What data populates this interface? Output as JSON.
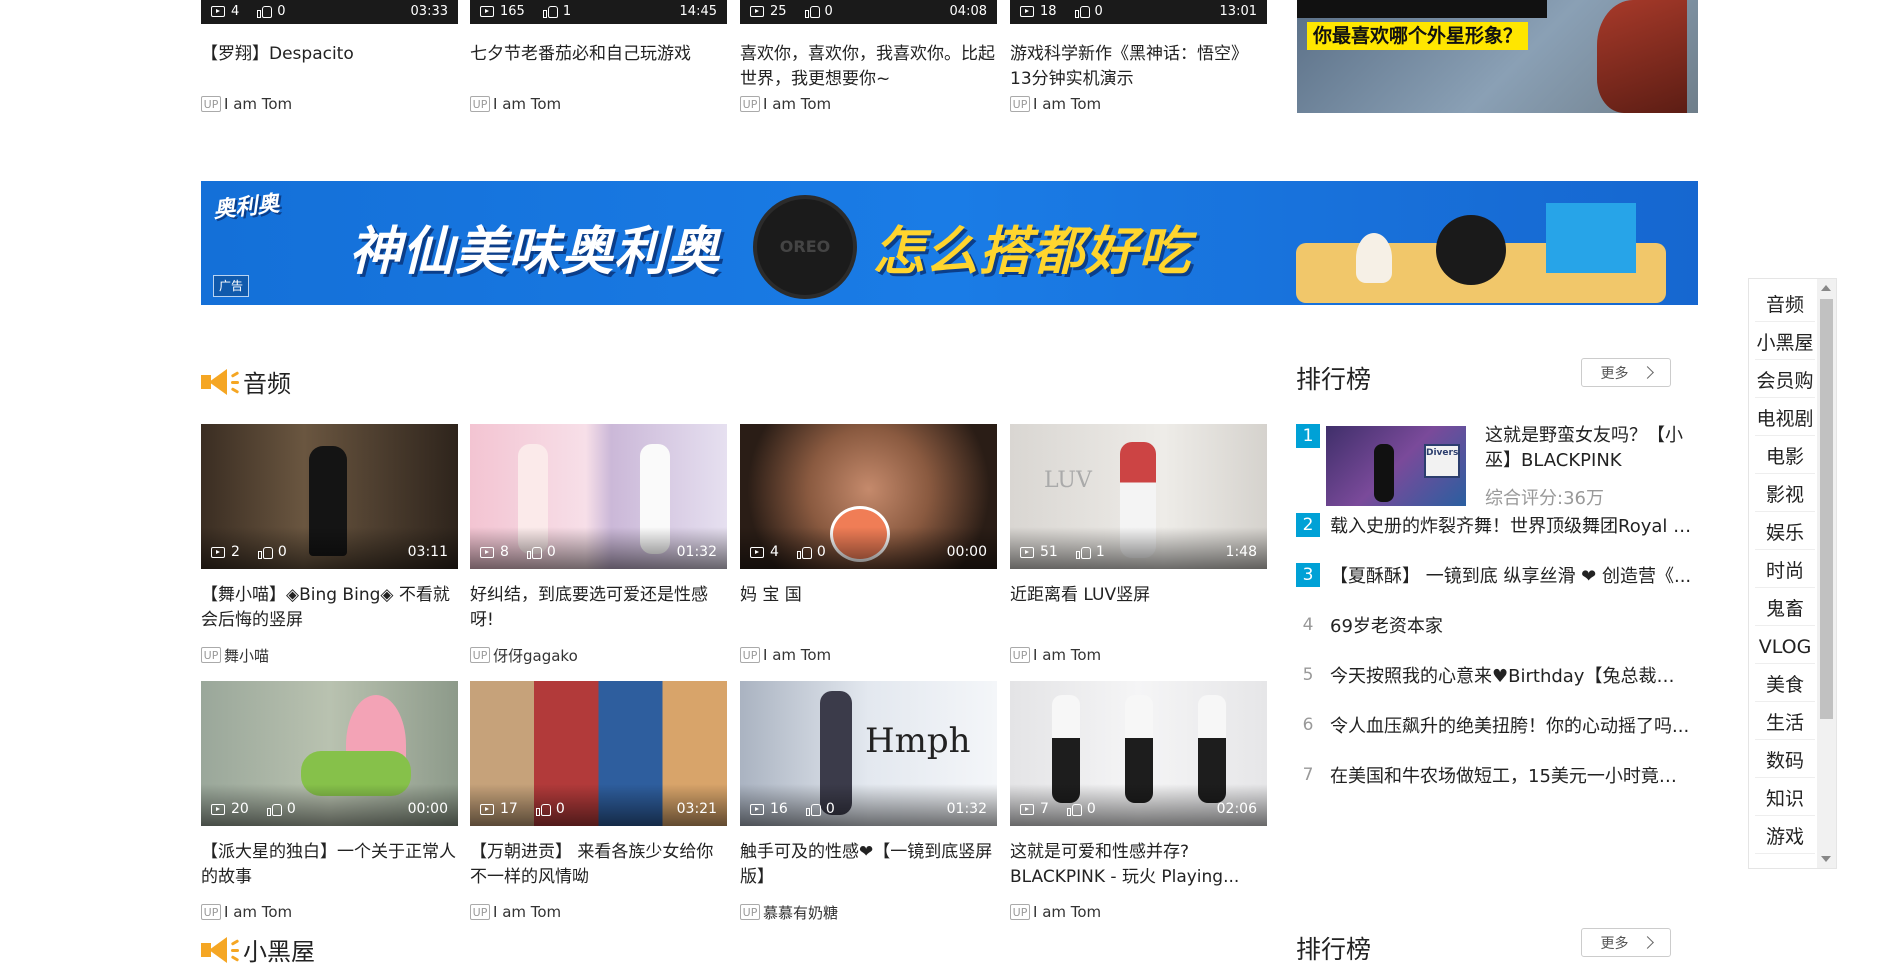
{
  "top_row": [
    {
      "title": "【罗翔】Despacito",
      "views": "4",
      "likes": "0",
      "duration": "03:33",
      "uploader": "I am Tom"
    },
    {
      "title": "七夕节老番茄必和自己玩游戏",
      "views": "165",
      "likes": "1",
      "duration": "14:45",
      "uploader": "I am Tom"
    },
    {
      "title": "喜欢你，喜欢你，我喜欢你。比起世界，我更想要你~",
      "views": "25",
      "likes": "0",
      "duration": "04:08",
      "uploader": "I am Tom"
    },
    {
      "title": "游戏科学新作《黑神话：悟空》13分钟实机演示",
      "views": "18",
      "likes": "0",
      "duration": "13:01",
      "uploader": "I am Tom"
    }
  ],
  "top_right_promo": {
    "text": "你最喜欢哪个外星形象？"
  },
  "banner_ad": {
    "brand": "奥利奥",
    "slogan_left": "神仙美味奥利奥",
    "slogan_right": "怎么搭都好吃",
    "ad_tag": "广告",
    "cookie_text": "OREO"
  },
  "audio_section": {
    "heading": "音频",
    "videos": [
      {
        "title": "【舞小喵】◈Bing Bing◈ 不看就会后悔的竖屏",
        "views": "2",
        "likes": "0",
        "duration": "03:11",
        "uploader": "舞小喵"
      },
      {
        "title": "好纠结，到底要选可爱还是性感呀!",
        "views": "8",
        "likes": "0",
        "duration": "01:32",
        "uploader": "伢伢gagako"
      },
      {
        "title": "妈 宝 国",
        "views": "4",
        "likes": "0",
        "duration": "00:00",
        "uploader": "I am Tom"
      },
      {
        "title": "近距离看 LUV竖屏",
        "views": "51",
        "likes": "1",
        "duration": "1:48",
        "uploader": "I am Tom"
      },
      {
        "title": "【派大星的独白】一个关于正常人的故事",
        "views": "20",
        "likes": "0",
        "duration": "00:00",
        "uploader": "I am Tom"
      },
      {
        "title": "【万朝进贡】 来看各族少女给你不一样的风情呦",
        "views": "17",
        "likes": "0",
        "duration": "03:21",
        "uploader": "I am Tom"
      },
      {
        "title": "触手可及的性感❤【一镜到底竖屏版】",
        "views": "16",
        "likes": "0",
        "duration": "01:32",
        "uploader": "慕慕有奶糖"
      },
      {
        "title": "这就是可爱和性感并存? BLACKPINK - 玩火 Playing...",
        "views": "7",
        "likes": "0",
        "duration": "02:06",
        "uploader": "I am Tom"
      }
    ],
    "overlay_text": {
      "luv": "LUV",
      "hmph": "Hmph"
    }
  },
  "next_section": {
    "heading": "小黑屋"
  },
  "ranking": {
    "title": "排行榜",
    "more": "更多",
    "featured": {
      "rank": "1",
      "title": "这就是野蛮女友吗？【小巫】BLACKPINK《Pret...",
      "score": "综合评分:36万",
      "thumb_sign": "Divers"
    },
    "items": [
      {
        "rank": "2",
        "title": "载入史册的炸裂齐舞！世界顶级舞团Royal F..."
      },
      {
        "rank": "3",
        "title": "【夏酥酥】 一镜到底 纵享丝滑 ❤ 创造营《..."
      },
      {
        "rank": "4",
        "title": "69岁老资本家"
      },
      {
        "rank": "5",
        "title": "今天按照我的心意来♥Birthday【兔总裁生日..."
      },
      {
        "rank": "6",
        "title": "令人血压飙升的绝美扭胯！你的心动摇了吗..."
      },
      {
        "rank": "7",
        "title": "在美国和牛农场做短工，15美元一小时竟然..."
      }
    ]
  },
  "ranking2": {
    "title": "排行榜",
    "more": "更多"
  },
  "side_nav": [
    "音频",
    "小黑屋",
    "会员购",
    "电视剧",
    "电影",
    "影视",
    "娱乐",
    "时尚",
    "鬼畜",
    "VLOG",
    "美食",
    "生活",
    "数码",
    "知识",
    "游戏"
  ],
  "up_badge": "UP"
}
